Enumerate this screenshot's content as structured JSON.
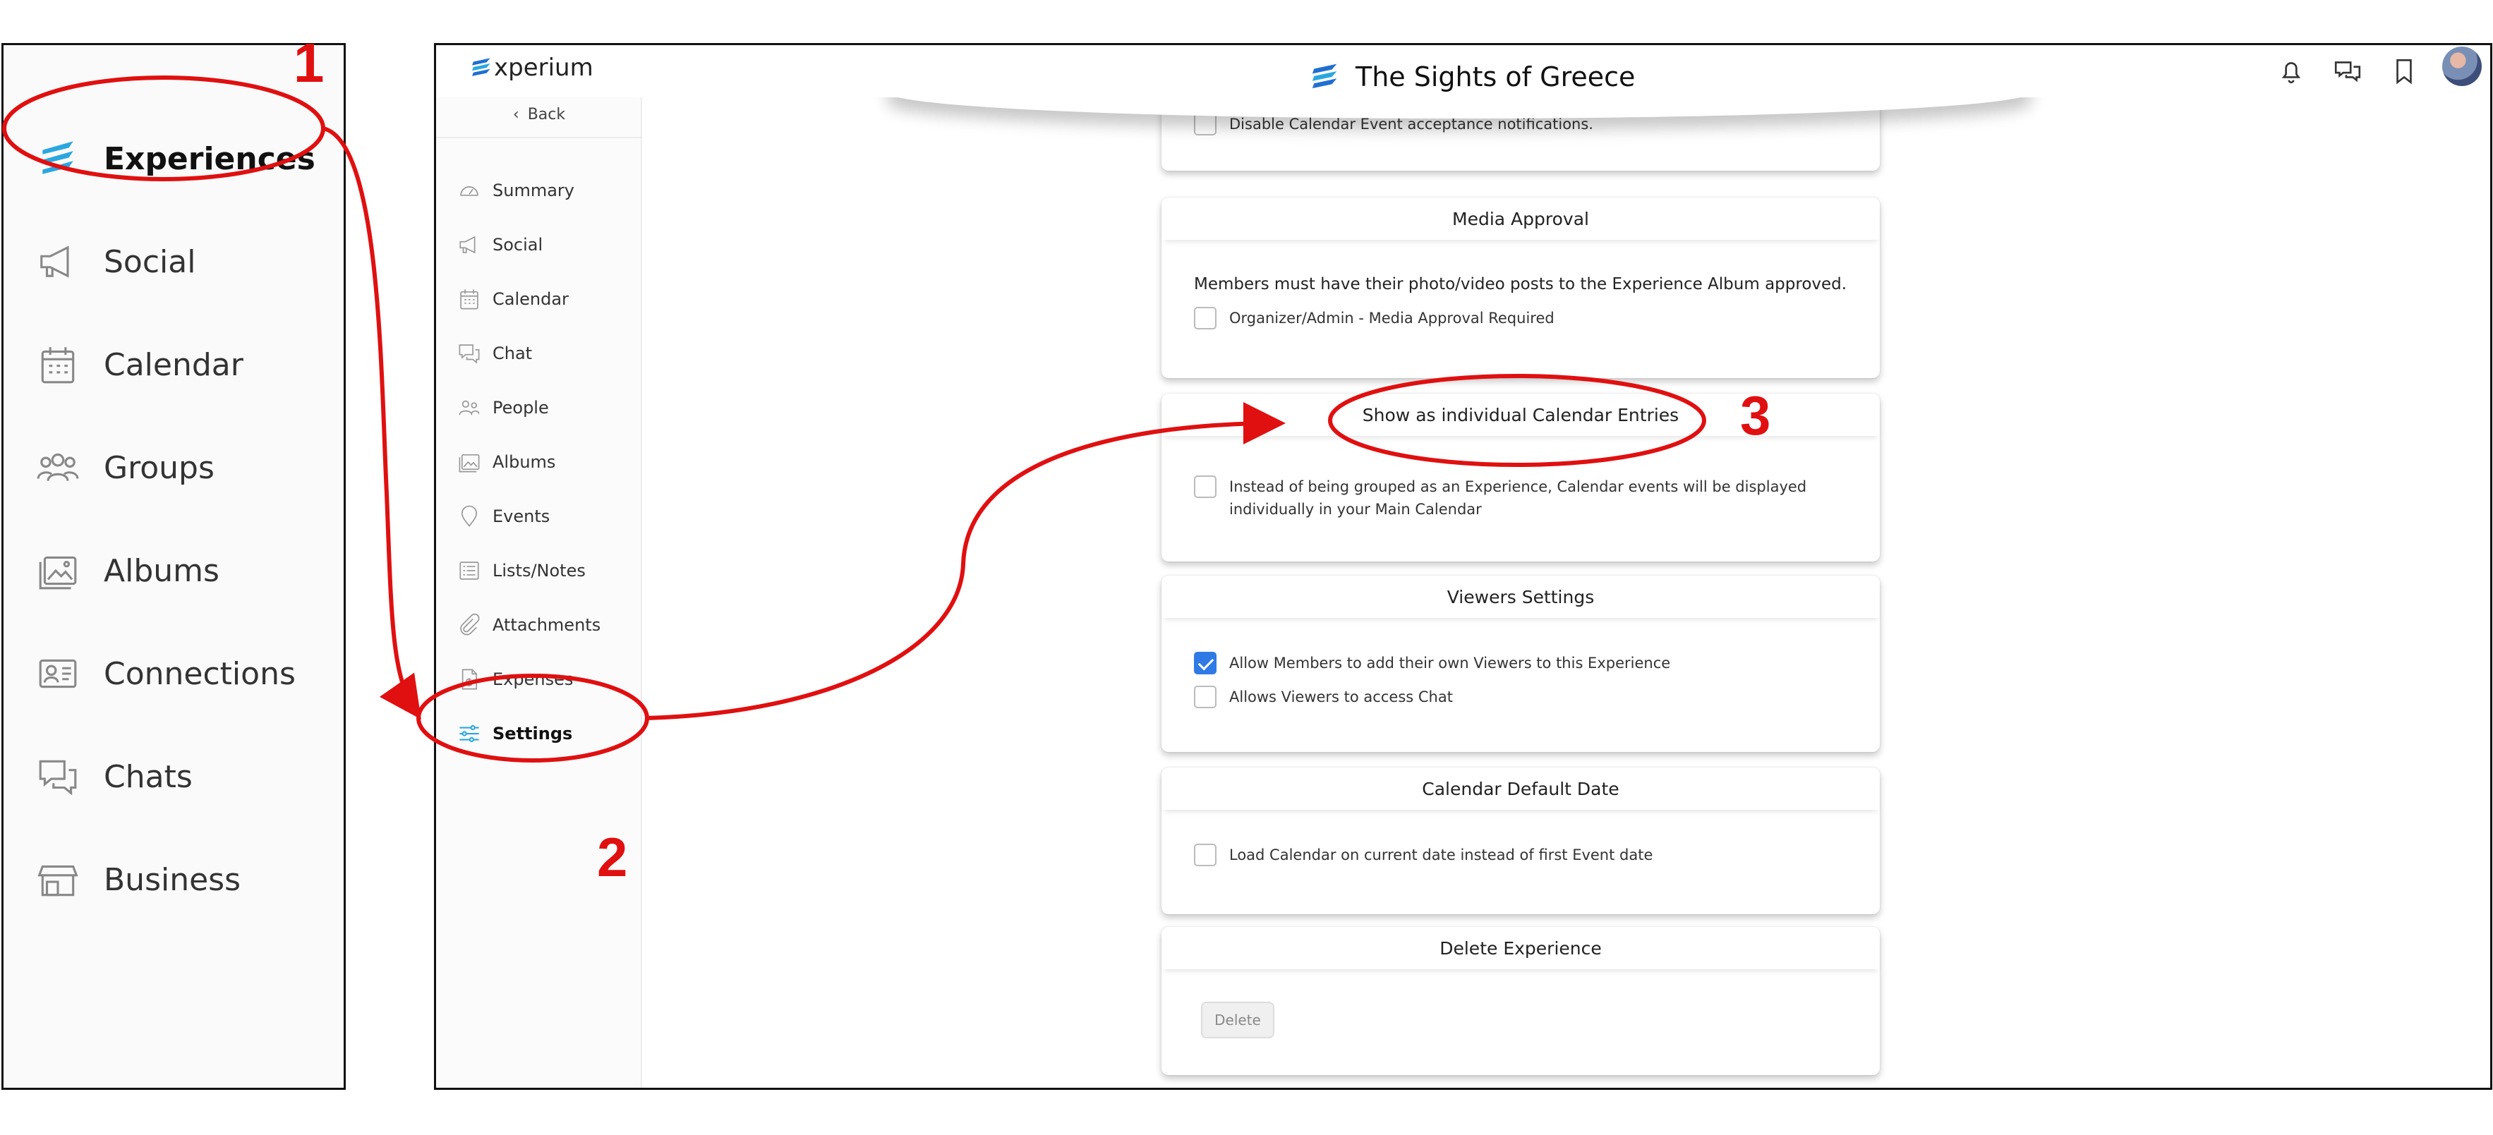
{
  "left_nav": {
    "items": [
      {
        "label": "Experiences",
        "icon": "experium-logo-icon",
        "active": true
      },
      {
        "label": "Social",
        "icon": "megaphone-icon"
      },
      {
        "label": "Calendar",
        "icon": "calendar-icon"
      },
      {
        "label": "Groups",
        "icon": "people-icon"
      },
      {
        "label": "Albums",
        "icon": "albums-icon"
      },
      {
        "label": "Connections",
        "icon": "contact-card-icon"
      },
      {
        "label": "Chats",
        "icon": "chat-icon"
      },
      {
        "label": "Business",
        "icon": "storefront-icon"
      }
    ]
  },
  "app": {
    "logo_text": "xperium",
    "title": "The Sights of Greece",
    "top_icons": [
      "bell-icon",
      "chats-icon",
      "bookmark-icon"
    ],
    "sidebar": {
      "back_label": "Back",
      "items": [
        {
          "label": "Summary",
          "icon": "gauge-icon"
        },
        {
          "label": "Social",
          "icon": "megaphone-icon"
        },
        {
          "label": "Calendar",
          "icon": "calendar-icon"
        },
        {
          "label": "Chat",
          "icon": "chat-icon"
        },
        {
          "label": "People",
          "icon": "people-icon"
        },
        {
          "label": "Albums",
          "icon": "albums-icon"
        },
        {
          "label": "Events",
          "icon": "location-pin-icon"
        },
        {
          "label": "Lists/Notes",
          "icon": "list-icon"
        },
        {
          "label": "Attachments",
          "icon": "paperclip-icon"
        },
        {
          "label": "Expenses",
          "icon": "receipt-icon"
        },
        {
          "label": "Settings",
          "icon": "sliders-icon",
          "active": true
        }
      ]
    },
    "cards": {
      "calendar_notifications": {
        "checkbox": "Disable Calendar Event acceptance notifications.",
        "checked": false
      },
      "media_approval": {
        "title": "Media Approval",
        "description": "Members must have their photo/video posts to the Experience Album approved.",
        "checkbox": "Organizer/Admin - Media Approval Required",
        "checked": false
      },
      "calendar_entries": {
        "title": "Show as individual Calendar Entries",
        "checkbox_line1": "Instead of being grouped as an Experience, Calendar events will be displayed",
        "checkbox_line2": "individually in your Main Calendar",
        "checked": false
      },
      "viewers": {
        "title": "Viewers Settings",
        "checkbox1": "Allow Members to add their own Viewers to this Experience",
        "checked1": true,
        "checkbox2": "Allows Viewers to access Chat",
        "checked2": false
      },
      "default_date": {
        "title": "Calendar Default Date",
        "checkbox": "Load Calendar on current date instead of first Event date",
        "checked": false
      },
      "delete": {
        "title": "Delete Experience",
        "button": "Delete"
      }
    }
  },
  "annotations": {
    "labels": [
      "1",
      "2",
      "3"
    ],
    "color": "#e01010"
  }
}
